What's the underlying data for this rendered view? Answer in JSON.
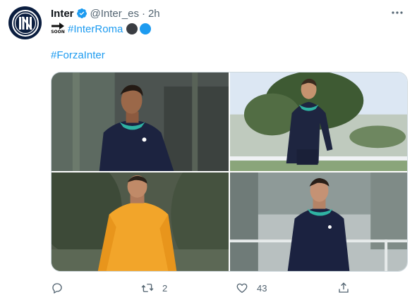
{
  "tweet": {
    "author": {
      "name": "Inter",
      "handle": "@Inter_es",
      "time": "2h",
      "dot": "·",
      "avatar_icon": "inter-logo",
      "verified_icon": "verified-badge-icon"
    },
    "text": {
      "soon_emoji_label": "SOON",
      "hashtag1": "#InterRoma",
      "hashtag2": "#ForzaInter"
    },
    "colors": {
      "link": "#1d9bf0",
      "circle_black": "#3a3d42",
      "circle_blue": "#1d9bf0",
      "muted": "#536471"
    },
    "media": [
      {
        "icon": "photo-player-smiling-navy-kit"
      },
      {
        "icon": "photo-player-walking-navy-kit"
      },
      {
        "icon": "photo-goalkeeper-orange-kit"
      },
      {
        "icon": "photo-young-player-navy-kit"
      }
    ],
    "actions": {
      "reply_count": "",
      "retweet_count": "2",
      "like_count": "43",
      "share_count": ""
    }
  }
}
